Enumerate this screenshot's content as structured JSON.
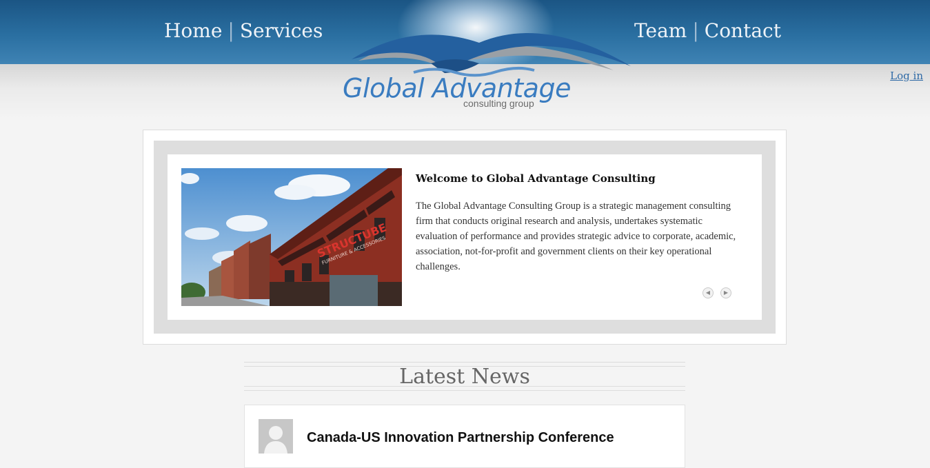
{
  "nav": {
    "left": [
      "Home",
      "Services"
    ],
    "right": [
      "Team",
      "Contact"
    ],
    "separator": "|"
  },
  "logo": {
    "name": "Global Advantage",
    "tagline": "consulting group"
  },
  "header": {
    "login_label": "Log in"
  },
  "slider": {
    "title": "Welcome to Global Advantage Consulting",
    "text": "The Global Advantage Consulting Group is a strategic management consulting firm that conducts original research and analysis, undertakes systematic evaluation of performance and provides strategic advice to corporate, academic, association, not-for-profit and government clients on their key operational challenges.",
    "prev_icon": "chevron-left-icon",
    "next_icon": "chevron-right-icon",
    "photo_sign": "STRUCTUBE",
    "photo_sign_sub": "FURNITURE & ACCESSORIES"
  },
  "news": {
    "heading": "Latest News",
    "items": [
      {
        "title": "Canada-US Innovation Partnership Conference",
        "avatar_icon": "user-avatar-icon"
      }
    ]
  },
  "colors": {
    "header": "#2a6fa1",
    "logo_text": "#3a7cc0",
    "link": "#2f6aa6",
    "background": "#f4f4f4"
  }
}
